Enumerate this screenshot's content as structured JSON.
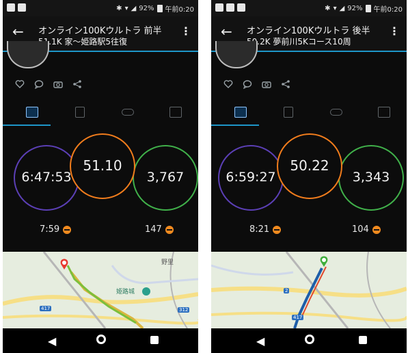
{
  "screens": [
    {
      "status": {
        "battery": "92%",
        "time": "午前0:20"
      },
      "header": {
        "title": "オンライン100Kウルトラ 前半",
        "subtitle": "51.1K 家〜姫路駅5往復"
      },
      "metrics": {
        "time": "6:47:53",
        "distance": "51.10",
        "calories": "3,767",
        "pace": "7:59",
        "heart_rate": "147"
      },
      "map": {
        "labels": [
          "野里",
          "姫路城",
          "417",
          "312"
        ]
      }
    },
    {
      "status": {
        "battery": "92%",
        "time": "午前0:20"
      },
      "header": {
        "title": "オンライン100Kウルトラ 後半",
        "subtitle": "50.2K 夢前川5Kコース10周"
      },
      "metrics": {
        "time": "6:59:27",
        "distance": "50.22",
        "calories": "3,343",
        "pace": "8:21",
        "heart_rate": "104"
      },
      "map": {
        "labels": [
          "2",
          "417"
        ]
      }
    }
  ],
  "colors": {
    "accent": "#1e96c8",
    "ring_time": "#5b3fb5",
    "ring_distance": "#f07c1c",
    "ring_calories": "#40b04a",
    "heart": "#f08a1f"
  }
}
